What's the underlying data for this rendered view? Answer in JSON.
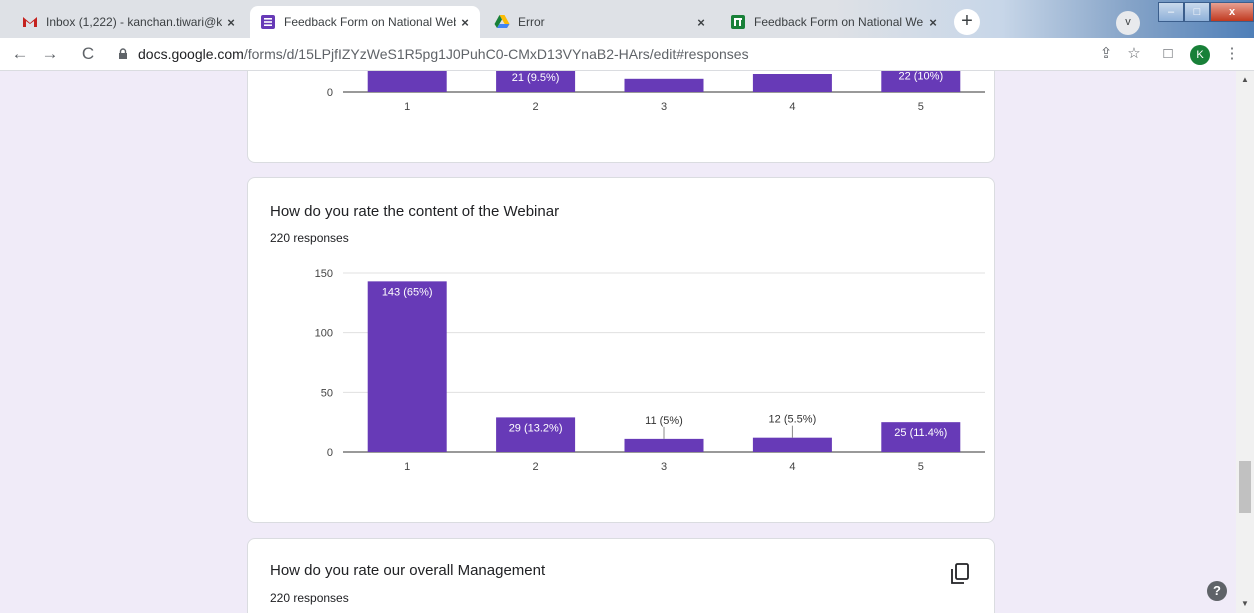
{
  "tabs": [
    {
      "title": "Inbox (1,222) - kanchan.tiwari@k",
      "icon": "gmail-icon",
      "close": "×"
    },
    {
      "title": "Feedback Form on National Web",
      "icon": "google-forms-icon",
      "close": "×"
    },
    {
      "title": "Error",
      "icon": "google-drive-icon",
      "close": "×"
    },
    {
      "title": "Feedback Form on National Web",
      "icon": "google-sheets-icon",
      "close": "×"
    }
  ],
  "new_tab": "+",
  "tab_search": "v",
  "window_controls": {
    "minimize": "–",
    "maximize": "□",
    "close": "x"
  },
  "toolbar": {
    "back": "←",
    "forward": "→",
    "reload": "C",
    "url_domain": "docs.google.com",
    "url_path": "/forms/d/15LPjfIZYzWeS1R5pg1J0PuhC0-CMxD13VYnaB2-HArs/edit#responses",
    "share": "⇪",
    "bookmark": "☆",
    "sidebar": "□",
    "menu": "⋮",
    "avatar_letter": "K"
  },
  "questions": [
    {
      "title": "",
      "responses": ""
    },
    {
      "title": "How do you rate the content of the Webinar",
      "responses": "220 responses"
    },
    {
      "title": "How do you rate our overall Management",
      "responses": "220 responses"
    }
  ],
  "chart_data": [
    {
      "type": "bar",
      "categories": [
        "1",
        "2",
        "3",
        "4",
        "5"
      ],
      "visible_labels": [
        "",
        "21 (9.5%)",
        "",
        "",
        "22 (10%)"
      ],
      "ylim": [
        0,
        150
      ],
      "yticks": [
        "0"
      ],
      "values": [
        150,
        21,
        11,
        15,
        22
      ],
      "colors": {
        "bar": "#673ab7"
      }
    },
    {
      "type": "bar",
      "categories": [
        "1",
        "2",
        "3",
        "4",
        "5"
      ],
      "values": [
        143,
        29,
        11,
        12,
        25
      ],
      "labels": [
        "143 (65%)",
        "29 (13.2%)",
        "11 (5%)",
        "12 (5.5%)",
        "25 (11.4%)"
      ],
      "ylim": [
        0,
        150
      ],
      "yticks": [
        "0",
        "50",
        "100",
        "150"
      ],
      "colors": {
        "bar": "#673ab7"
      }
    }
  ],
  "scrollbar": {
    "up": "▲",
    "down": "▼"
  },
  "help": "?"
}
